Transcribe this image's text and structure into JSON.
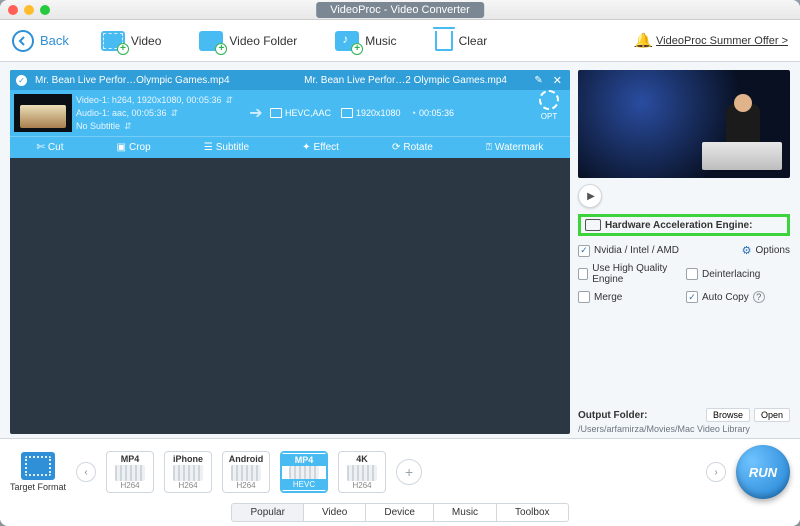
{
  "window": {
    "title": "VideoProc - Video Converter"
  },
  "topbar": {
    "back": "Back",
    "video": "Video",
    "video_folder": "Video Folder",
    "music": "Music",
    "clear": "Clear",
    "promo": "VideoProc Summer Offer >"
  },
  "item": {
    "check": "✓",
    "source_name": "Mr. Bean Live Perfor…Olympic Games.mp4",
    "output_name": "Mr. Bean Live Perfor…2 Olympic Games.mp4",
    "video_line": "Video-1: h264, 1920x1080, 00:05:36",
    "audio_line": "Audio-1: aac, 00:05:36",
    "subtitle_line": "No Subtitle",
    "out_codec": "HEVC,AAC",
    "out_res": "1920x1080",
    "out_dur": "00:05:36",
    "opt_label": "OPT",
    "tools": {
      "cut": "Cut",
      "crop": "Crop",
      "subtitle": "Subtitle",
      "effect": "Effect",
      "rotate": "Rotate",
      "watermark": "Watermark"
    }
  },
  "right": {
    "hw_label": "Hardware Acceleration Engine:",
    "opt_nvidia": "Nvidia / Intel / AMD",
    "opt_options": "Options",
    "opt_hq": "Use High Quality Engine",
    "opt_deint": "Deinterlacing",
    "opt_merge": "Merge",
    "opt_autocopy": "Auto Copy",
    "out_label": "Output Folder:",
    "browse": "Browse",
    "open": "Open",
    "out_path": "/Users/arfamirza/Movies/Mac Video Library"
  },
  "bottom": {
    "target_label": "Target Format",
    "presets": [
      {
        "top": "MP4",
        "bot": "H264"
      },
      {
        "top": "iPhone",
        "bot": "H264"
      },
      {
        "top": "Android",
        "bot": "H264"
      },
      {
        "top": "MP4",
        "bot": "HEVC"
      },
      {
        "top": "4K",
        "bot": "H264"
      }
    ],
    "tabs": [
      "Popular",
      "Video",
      "Device",
      "Music",
      "Toolbox"
    ],
    "run": "RUN"
  }
}
